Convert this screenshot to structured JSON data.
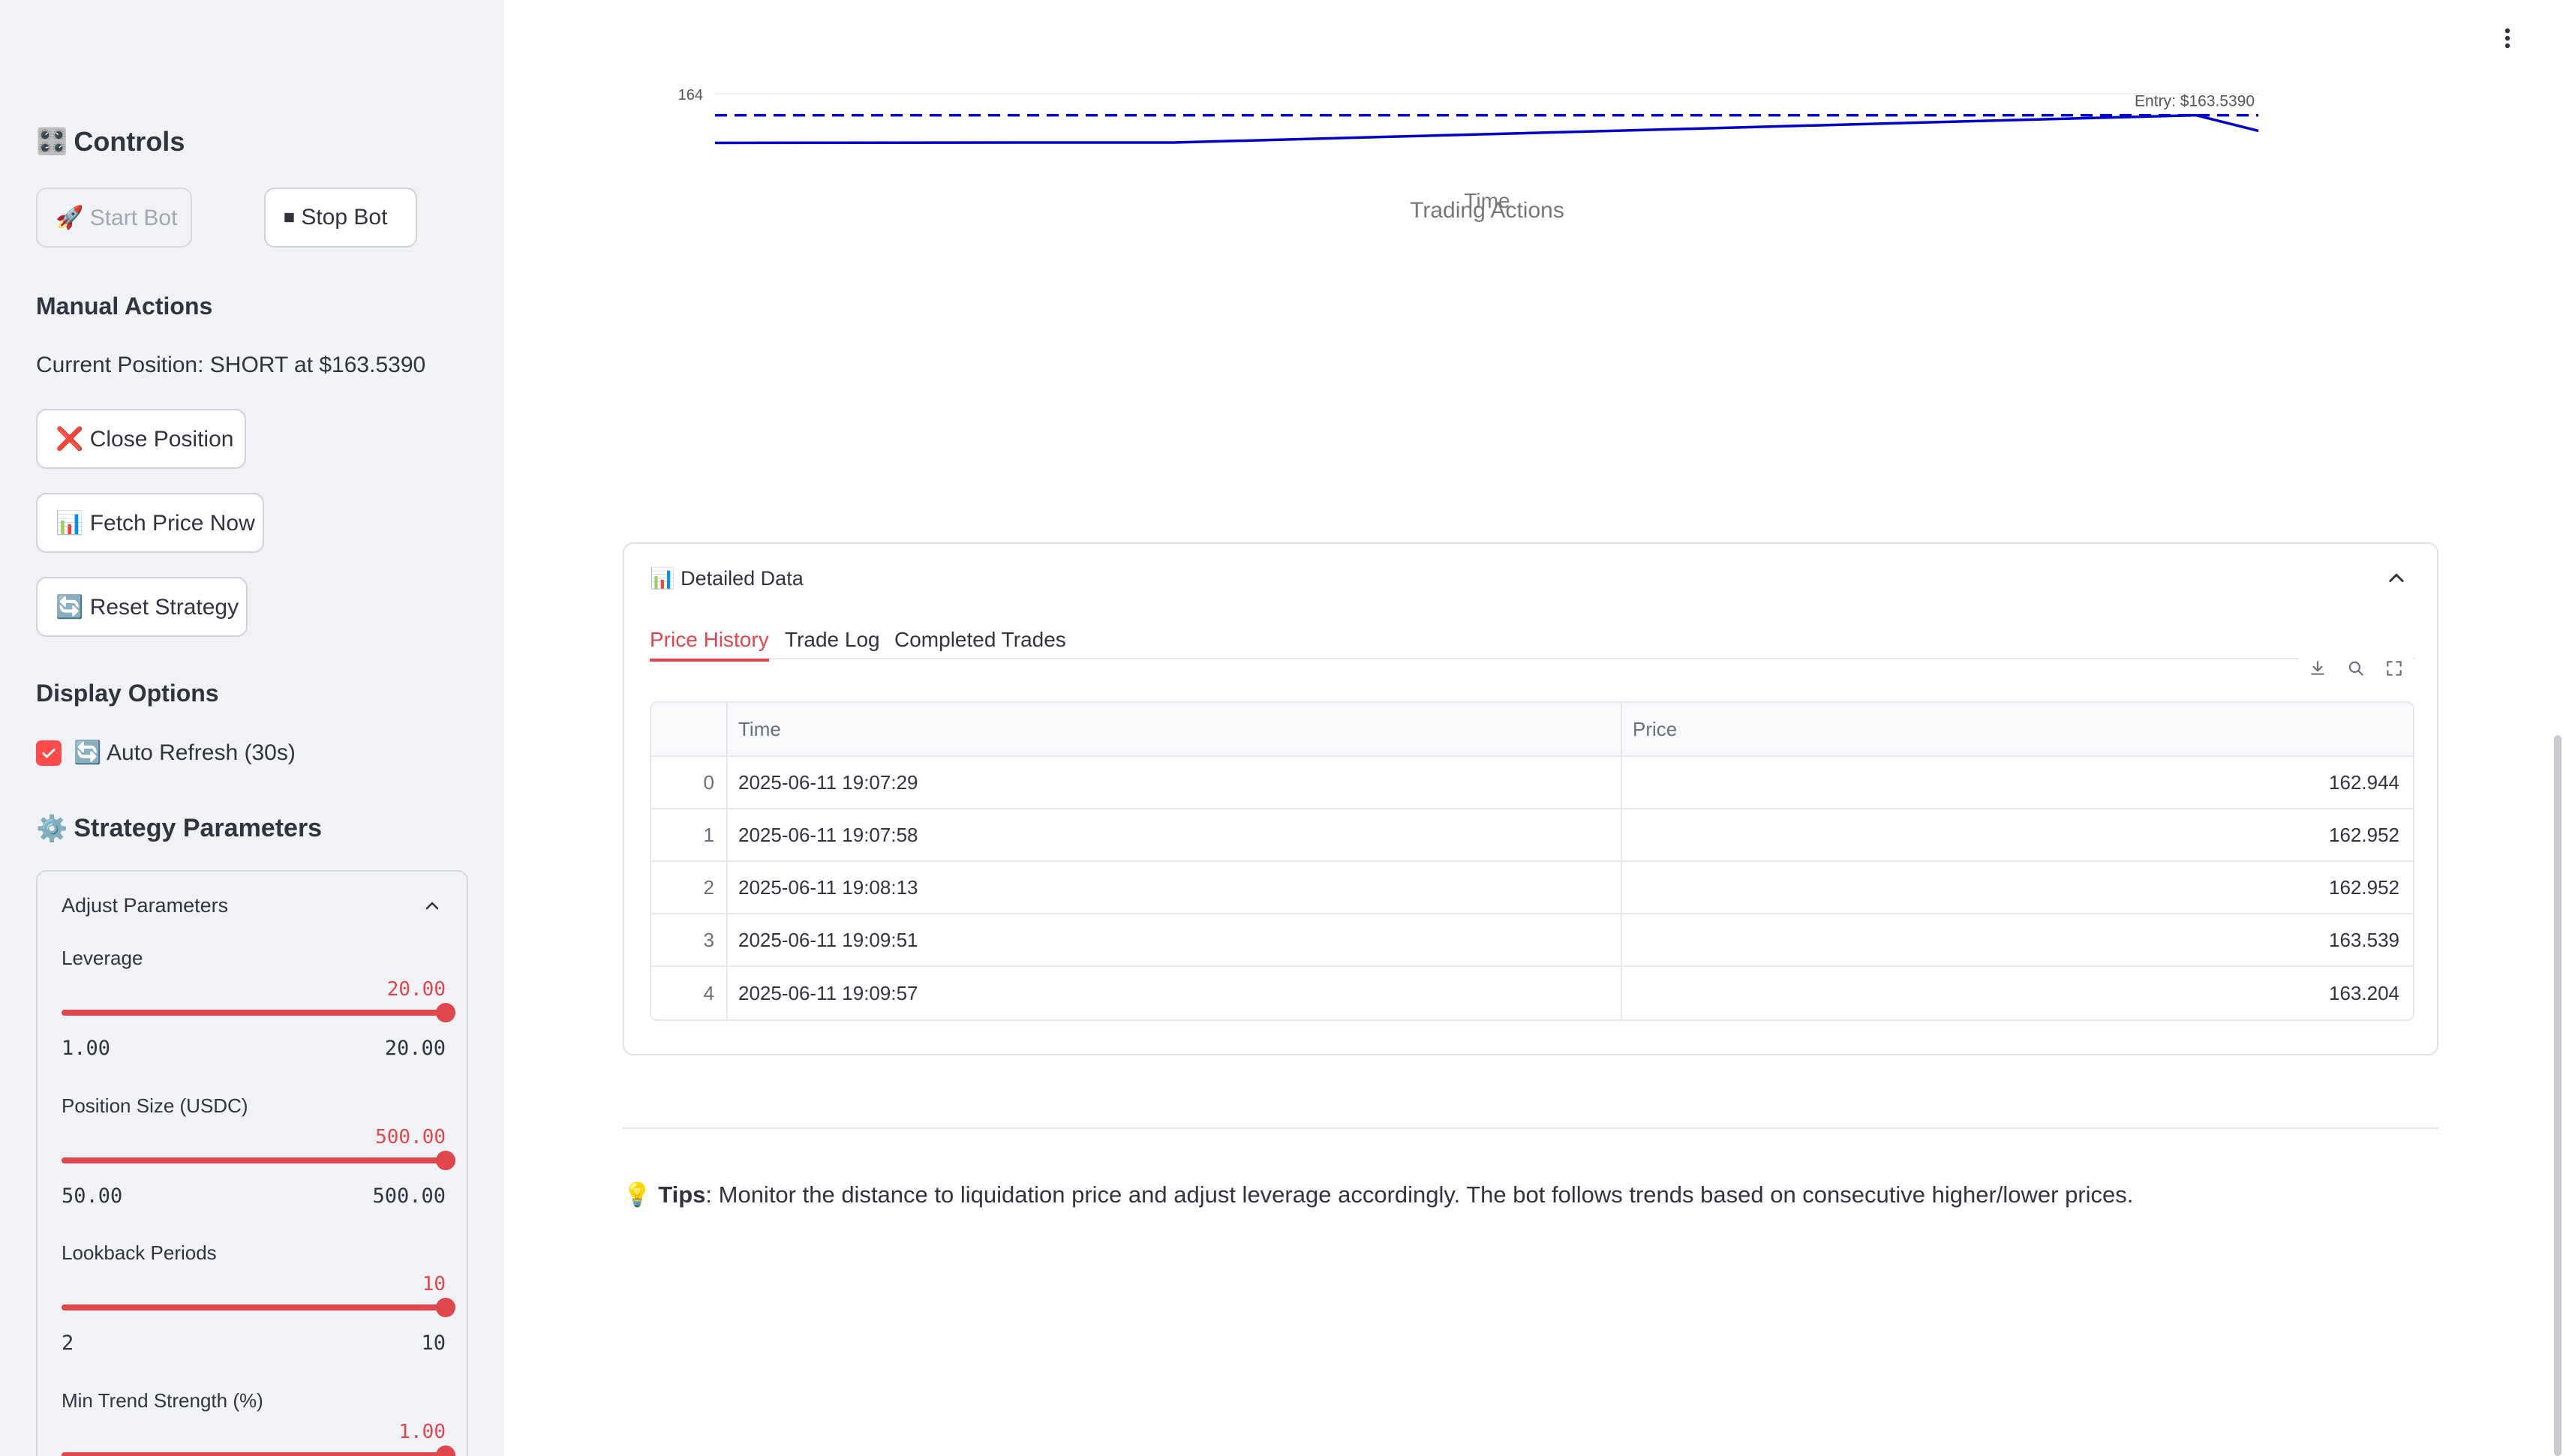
{
  "sidebar": {
    "controls_title": "Controls",
    "controls_icon": "control-knobs-icon",
    "start_button": "🚀 Start Bot",
    "stop_button": "⏹ Stop Bot",
    "manual_actions_title": "Manual Actions",
    "current_position": "Current Position: SHORT at $163.5390",
    "close_button": "❌ Close Position",
    "fetch_button": "📊 Fetch Price Now",
    "reset_button": "🔄 Reset Strategy",
    "display_options_title": "Display Options",
    "auto_refresh_label": "🔄 Auto Refresh (30s)",
    "auto_refresh_checked": true,
    "strategy_title": "Strategy Parameters",
    "strategy_icon": "gear-icon",
    "adjust_params_title": "Adjust Parameters",
    "sliders": [
      {
        "label": "Leverage",
        "value": "20.00",
        "min": "1.00",
        "max": "20.00",
        "fraction": 1.0
      },
      {
        "label": "Position Size (USDC)",
        "value": "500.00",
        "min": "50.00",
        "max": "500.00",
        "fraction": 1.0
      },
      {
        "label": "Lookback Periods",
        "value": "10",
        "min": "2",
        "max": "10",
        "fraction": 1.0
      },
      {
        "label": "Min Trend Strength (%)",
        "value": "1.00",
        "min": "",
        "max": "",
        "fraction": 1.0
      }
    ]
  },
  "chart_data": {
    "type": "line",
    "ytick_label": "164",
    "entry_label": "Entry: $163.5390",
    "entry_value": 163.539,
    "xlabel": "Time",
    "title": "Trading Actions",
    "series": [
      {
        "values": [
          162.944,
          162.952,
          162.952,
          163.539,
          163.204
        ]
      }
    ],
    "colors": {
      "line": "#0000cc",
      "entry": "#0000cc"
    }
  },
  "detailed": {
    "title": "📊 Detailed Data",
    "tabs": [
      "Price History",
      "Trade Log",
      "Completed Trades"
    ],
    "active_tab": 0,
    "columns": [
      "",
      "Time",
      "Price"
    ],
    "rows": [
      [
        "0",
        "2025-06-11 19:07:29",
        "162.944"
      ],
      [
        "1",
        "2025-06-11 19:07:58",
        "162.952"
      ],
      [
        "2",
        "2025-06-11 19:08:13",
        "162.952"
      ],
      [
        "3",
        "2025-06-11 19:09:51",
        "163.539"
      ],
      [
        "4",
        "2025-06-11 19:09:57",
        "163.204"
      ]
    ]
  },
  "tips": {
    "icon": "💡",
    "bold": "Tips",
    "text": ": Monitor the distance to liquidation price and adjust leverage accordingly. The bot follows trends based on consecutive higher/lower prices."
  },
  "colors": {
    "accent": "#e0474c",
    "sidebar_bg": "#f0f2f6"
  }
}
